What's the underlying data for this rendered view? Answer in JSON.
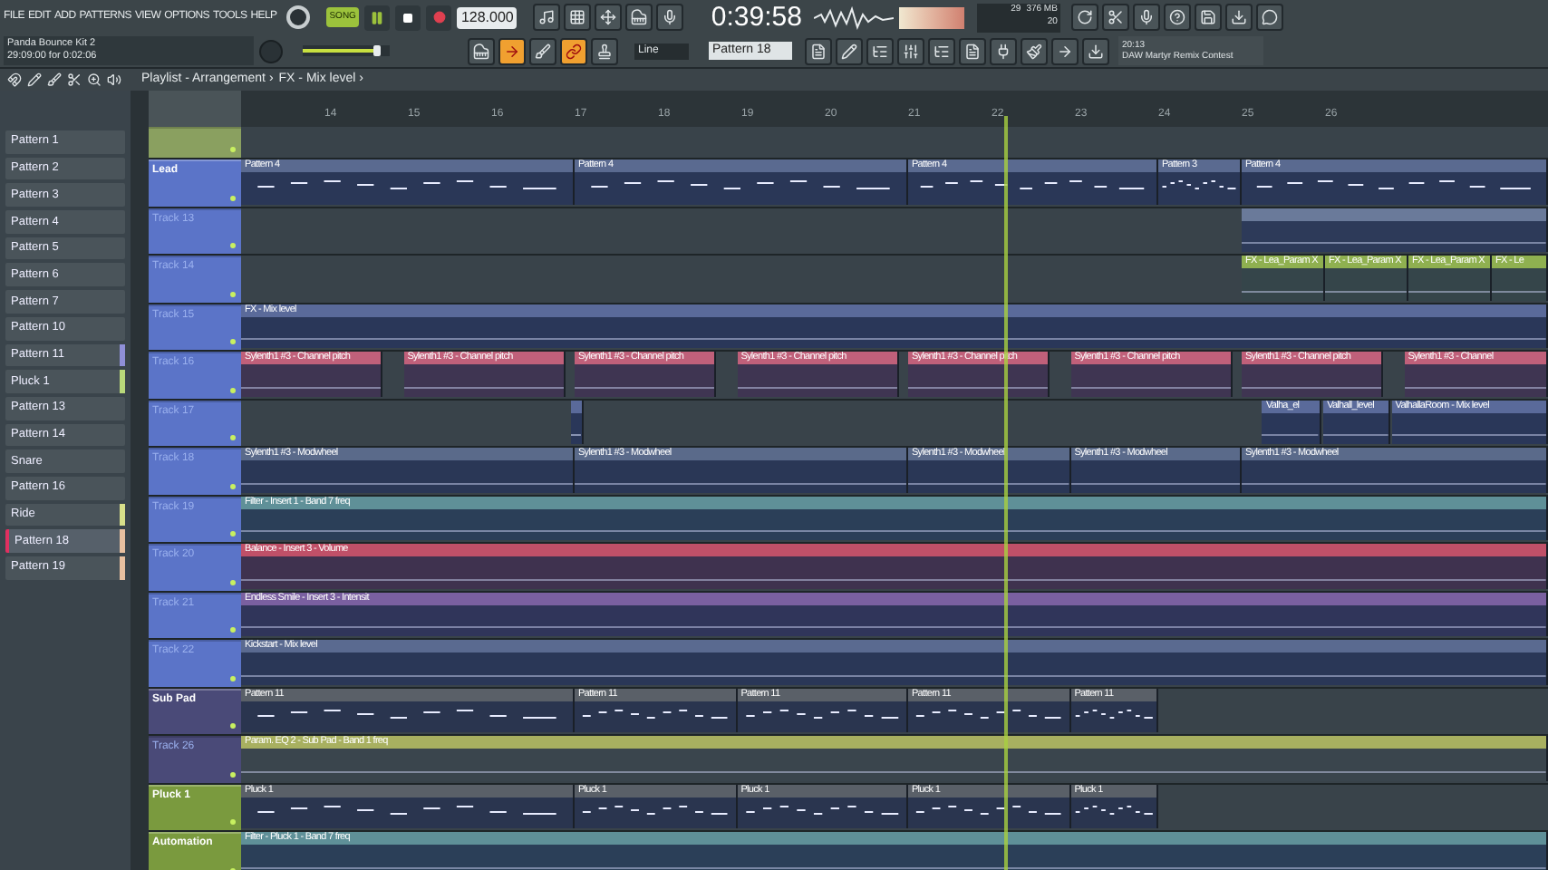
{
  "menu": [
    "FILE",
    "EDIT",
    "ADD",
    "PATTERNS",
    "VIEW",
    "OPTIONS",
    "TOOLS",
    "HELP"
  ],
  "transport": {
    "mode": "SONG",
    "song_mode": true,
    "playing": true
  },
  "tempo": "128.000",
  "time": "0:39:58",
  "cpu": {
    "value": "29",
    "memory": "376 MB",
    "polyphony": "20"
  },
  "hint": {
    "title": "Panda Bounce Kit 2",
    "detail": "29:09:00 for 0:02:06"
  },
  "master_volume": {
    "level": 0.85
  },
  "tools": [
    {
      "kind": "piano",
      "selected": false
    },
    {
      "kind": "arrow",
      "selected": true
    },
    {
      "kind": "brush",
      "selected": false
    },
    {
      "kind": "link",
      "selected": true
    },
    {
      "kind": "stamp",
      "selected": false
    }
  ],
  "snap": "Line",
  "current_pattern": "Pattern 18",
  "news": {
    "time": "20:13",
    "text": "DAW Martyr Remix Contest"
  },
  "breadcrumb": {
    "items": [
      "Playlist - Arrangement",
      "FX - Mix level"
    ],
    "separator": "›"
  },
  "patterns": [
    {
      "name": "Pattern 1",
      "selected": false
    },
    {
      "name": "Pattern 2",
      "selected": false
    },
    {
      "name": "Pattern 3",
      "selected": false
    },
    {
      "name": "Pattern 4",
      "selected": false
    },
    {
      "name": "Pattern 5",
      "selected": false
    },
    {
      "name": "Pattern 6",
      "selected": false
    },
    {
      "name": "Pattern 7",
      "selected": false
    },
    {
      "name": "Pattern 10",
      "selected": false
    },
    {
      "name": "Pattern 11",
      "selected": false,
      "color": "#8f8fd8"
    },
    {
      "name": "Pluck 1",
      "selected": false,
      "color": "#b8d87a"
    },
    {
      "name": "Pattern 13",
      "selected": false
    },
    {
      "name": "Pattern 14",
      "selected": false
    },
    {
      "name": "Snare",
      "selected": false
    },
    {
      "name": "Pattern 16",
      "selected": false
    },
    {
      "name": "Ride",
      "selected": false,
      "color": "#d8e08a"
    },
    {
      "name": "Pattern 18",
      "selected": true,
      "color": "#e8c0a0"
    },
    {
      "name": "Pattern 19",
      "selected": false,
      "color": "#e8c0a0"
    }
  ],
  "ruler": [
    "14",
    "15",
    "16",
    "17",
    "18",
    "19",
    "20",
    "21",
    "22",
    "23",
    "24",
    "25",
    "26"
  ],
  "tracks": [
    {
      "kind": "generic",
      "color": "#8aa060"
    },
    {
      "name": "Lead",
      "kind": "named",
      "color": "#5b74c8",
      "clips": [
        {
          "label": "Pattern 4",
          "kind": "pattern",
          "color": "#5a6a90"
        },
        {
          "label": "Pattern 4",
          "kind": "pattern",
          "color": "#5a6a90"
        },
        {
          "label": "Pattern 4",
          "kind": "pattern",
          "color": "#5a6a90"
        },
        {
          "label": "Pattern 3",
          "kind": "pattern",
          "color": "#5a6a90"
        },
        {
          "label": "Pattern 4",
          "kind": "pattern",
          "color": "#5a6a90"
        }
      ]
    },
    {
      "name": "Track 13",
      "kind": "generic",
      "color": "#5b74c8",
      "clips": [
        {
          "kind": "automation",
          "color": "#6a7a9a"
        }
      ]
    },
    {
      "name": "Track 14",
      "kind": "generic",
      "color": "#5b74c8",
      "clips": [
        {
          "label": "FX - Lea_Param X",
          "kind": "automation",
          "color": "#8fb050"
        },
        {
          "label": "FX - Lea_Param X",
          "kind": "automation",
          "color": "#8fb050"
        },
        {
          "label": "FX - Lea_Param X",
          "kind": "automation",
          "color": "#8fb050"
        },
        {
          "label": "FX - Le",
          "kind": "automation",
          "color": "#8fb050"
        }
      ]
    },
    {
      "name": "Track 15",
      "kind": "generic",
      "color": "#5b74c8",
      "clips": [
        {
          "label": "FX - Mix level",
          "kind": "automation",
          "color": "#5a6a9a"
        }
      ]
    },
    {
      "name": "Track 16",
      "kind": "generic",
      "color": "#5b74c8",
      "clips": [
        {
          "label": "Sylenth1 #3 - Channel pitch",
          "kind": "automation",
          "color": "#c0607a"
        },
        {
          "label": "Sylenth1 #3 - Channel pitch",
          "kind": "automation",
          "color": "#c0607a"
        },
        {
          "label": "Sylenth1 #3 - Channel pitch",
          "kind": "automation",
          "color": "#c0607a"
        },
        {
          "label": "Sylenth1 #3 - Channel pitch",
          "kind": "automation",
          "color": "#c0607a"
        },
        {
          "label": "Sylenth1 #3 - Channel pitch",
          "kind": "automation",
          "color": "#c0607a"
        },
        {
          "label": "Sylenth1 #3 - Channel pitch",
          "kind": "automation",
          "color": "#c0607a"
        },
        {
          "label": "Sylenth1 #3 - Channel pitch",
          "kind": "automation",
          "color": "#c0607a"
        },
        {
          "label": "Sylenth1 #3 - Channel",
          "kind": "automation",
          "color": "#c0607a"
        }
      ]
    },
    {
      "name": "Track 17",
      "kind": "generic",
      "color": "#5b74c8",
      "clips": [
        {
          "kind": "automation",
          "color": "#5a6a9a"
        },
        {
          "label": "Valha_el",
          "kind": "automation",
          "color": "#5a6a9a"
        },
        {
          "label": "Valhall_level",
          "kind": "automation",
          "color": "#5a6a9a"
        },
        {
          "label": "ValhallaRoom - Mix level",
          "kind": "automation",
          "color": "#5a6a9a"
        }
      ]
    },
    {
      "name": "Track 18",
      "kind": "generic",
      "color": "#5b74c8",
      "clips": [
        {
          "label": "Sylenth1 #3 - Modwheel",
          "kind": "automation",
          "color": "#5a6a8a"
        },
        {
          "label": "Sylenth1 #3 - Modwheel",
          "kind": "automation",
          "color": "#5a6a8a"
        },
        {
          "label": "Sylenth1 #3 - Modwheel",
          "kind": "automation",
          "color": "#5a6a8a"
        },
        {
          "label": "Sylenth1 #3 - Modwheel",
          "kind": "automation",
          "color": "#5a6a8a"
        },
        {
          "label": "Sylenth1 #3 - Modwheel",
          "kind": "automation",
          "color": "#5a6a8a"
        }
      ]
    },
    {
      "name": "Track 19",
      "kind": "generic",
      "color": "#5b74c8",
      "clips": [
        {
          "label": "Filter - Insert 1 - Band 7 freq",
          "kind": "automation",
          "color": "#5f9098"
        }
      ]
    },
    {
      "name": "Track 20",
      "kind": "generic",
      "color": "#5b74c8",
      "clips": [
        {
          "label": "Balance - Insert 3 - Volume",
          "kind": "automation",
          "color": "#c05068"
        }
      ]
    },
    {
      "name": "Track 21",
      "kind": "generic",
      "color": "#5b74c8",
      "clips": [
        {
          "label": "Endless Smile - Insert 3 - Intensit",
          "kind": "automation",
          "color": "#7a60a0"
        }
      ]
    },
    {
      "name": "Track 22",
      "kind": "generic",
      "color": "#5b74c8",
      "clips": [
        {
          "label": "Kickstart - Mix level",
          "kind": "automation",
          "color": "#5a6a90"
        }
      ]
    },
    {
      "name": "Sub Pad",
      "kind": "named",
      "color": "#4a4a78",
      "clips": [
        {
          "label": "Pattern 11",
          "kind": "pattern",
          "color": "#5a6068"
        },
        {
          "label": "Pattern 11",
          "kind": "pattern",
          "color": "#5a6068"
        },
        {
          "label": "Pattern 11",
          "kind": "pattern",
          "color": "#5a6068"
        },
        {
          "label": "Pattern 11",
          "kind": "pattern",
          "color": "#5a6068"
        },
        {
          "label": "Pattern 11",
          "kind": "pattern",
          "color": "#5a6068"
        }
      ]
    },
    {
      "name": "Track 26",
      "kind": "generic",
      "color": "#4a4a78",
      "clips": [
        {
          "label": "Param. EQ 2 - Sub Pad - Band 1 freq",
          "kind": "automation",
          "color": "#a8b060"
        }
      ]
    },
    {
      "name": "Pluck 1",
      "kind": "named",
      "color": "#7a9a3e",
      "clips": [
        {
          "label": "Pluck 1",
          "kind": "pattern",
          "color": "#5a6068"
        },
        {
          "label": "Pluck 1",
          "kind": "pattern",
          "color": "#5a6068"
        },
        {
          "label": "Pluck 1",
          "kind": "pattern",
          "color": "#5a6068"
        },
        {
          "label": "Pluck 1",
          "kind": "pattern",
          "color": "#5a6068"
        },
        {
          "label": "Pluck 1",
          "kind": "pattern",
          "color": "#5a6068"
        }
      ]
    },
    {
      "name": "Automation",
      "kind": "named",
      "color": "#7a9a3e",
      "clips": [
        {
          "label": "Filter - Pluck 1 - Band 7 freq",
          "kind": "automation",
          "color": "#5f9098"
        }
      ]
    }
  ]
}
